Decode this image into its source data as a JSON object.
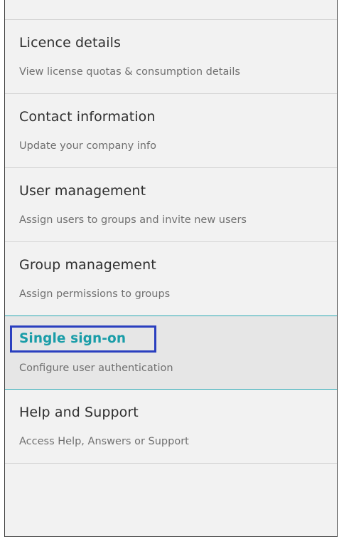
{
  "menu": {
    "items": [
      {
        "title": "Licence details",
        "description": "View license quotas & consumption details"
      },
      {
        "title": "Contact information",
        "description": "Update your company info"
      },
      {
        "title": "User management",
        "description": "Assign users to groups and invite new users"
      },
      {
        "title": "Group management",
        "description": "Assign permissions to groups"
      },
      {
        "title": "Single sign-on",
        "description": "Configure user authentication"
      },
      {
        "title": "Help and Support",
        "description": "Access Help, Answers or Support"
      }
    ]
  },
  "colors": {
    "panel_background": "#f2f2f2",
    "active_background": "#e6e6e6",
    "accent": "#1a9da8",
    "highlight_border": "#2a3fbf",
    "divider": "#d3d3d3"
  }
}
